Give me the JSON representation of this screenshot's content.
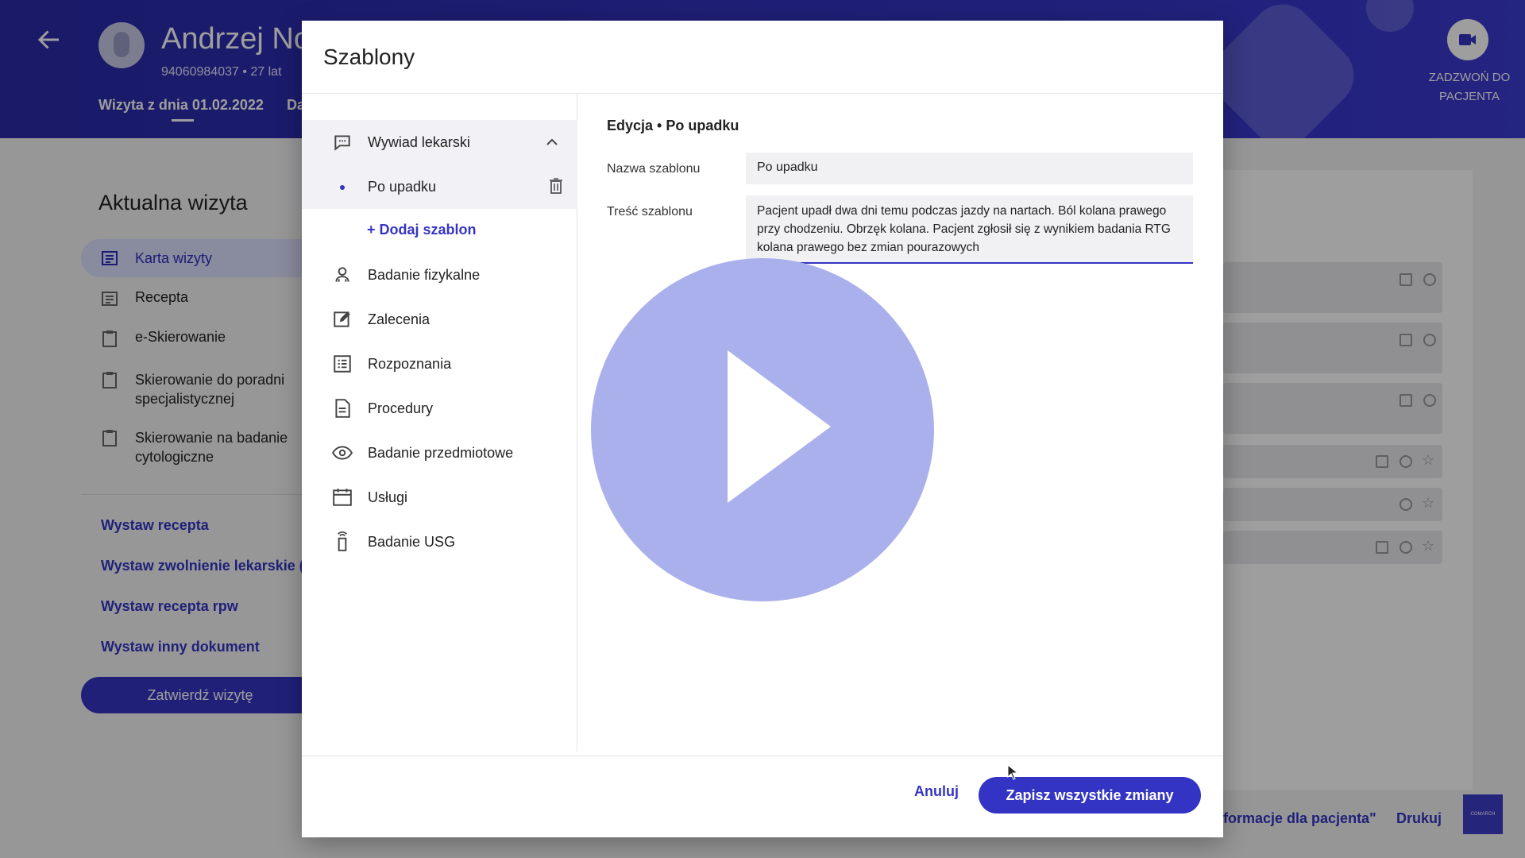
{
  "header": {
    "patient_name": "Andrzej No",
    "patient_meta": "94060984037 • 27 lat",
    "visit_tab": "Wizyta z dnia 01.02.2022",
    "visit_tab2": "Da",
    "call_label": "ZADZWOŃ DO PACJENTA"
  },
  "sidebar": {
    "title": "Aktualna wizyta",
    "items": [
      {
        "label": "Karta wizyty"
      },
      {
        "label": "Recepta"
      },
      {
        "label": "e-Skierowanie"
      },
      {
        "label": "Skierowanie do poradni specjalistycznej"
      },
      {
        "label": "Skierowanie na badanie cytologiczne"
      }
    ],
    "links": [
      "Wystaw recepta",
      "Wystaw zwolnienie lekarskie (e",
      "Wystaw recepta rpw",
      "Wystaw inny dokument"
    ],
    "confirm_label": "Zatwierdź wizytę"
  },
  "footer": {
    "info_link": "formacje dla pacjenta\"",
    "print_link": "Drukuj",
    "logo": "COMARCH"
  },
  "modal": {
    "title": "Szablony",
    "categories": [
      {
        "label": "Wywiad lekarski",
        "icon": "chat-icon"
      },
      {
        "label": "Badanie fizykalne",
        "icon": "stethoscope-icon"
      },
      {
        "label": "Zalecenia",
        "icon": "edit-icon"
      },
      {
        "label": "Rozpoznania",
        "icon": "list-icon"
      },
      {
        "label": "Procedury",
        "icon": "document-icon"
      },
      {
        "label": "Badanie przedmiotowe",
        "icon": "eye-icon"
      },
      {
        "label": "Usługi",
        "icon": "calendar-icon"
      },
      {
        "label": "Badanie USG",
        "icon": "ultrasound-icon"
      }
    ],
    "selected_template": "Po upadku",
    "add_template": "+ Dodaj szablon",
    "edit_heading": "Edycja • Po upadku",
    "name_label": "Nazwa szablonu",
    "name_value": "Po upadku",
    "content_label": "Treść szablonu",
    "content_value": "Pacjent upadł dwa dni temu podczas jazdy na nartach. Ból kolana prawego przy chodzeniu. Obrzęk kolana. Pacjent zgłosił się z wynikiem badania RTG kolana prawego bez zmian pourazowych",
    "cancel_label": "Anuluj",
    "save_label": "Zapisz wszystkie zmiany"
  },
  "colors": {
    "accent": "#3434c4",
    "header_bg": "#2a2aa8",
    "play_overlay": "#aab0ec"
  }
}
